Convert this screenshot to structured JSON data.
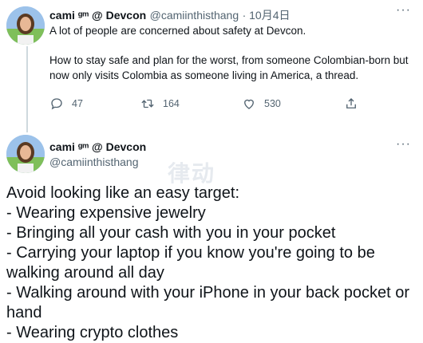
{
  "tweet1": {
    "name": "cami ᵍᵐ @ Devcon",
    "handle": "@camiinthisthang",
    "date": "· 10月4日",
    "text_line1": "A lot of people are concerned about safety at Devcon.",
    "text_para2": "How to stay safe and plan for the worst, from someone Colombian-born but now only visits Colombia as someone living in America, a thread.",
    "more_label": "···",
    "actions": {
      "replies": "47",
      "retweets": "164",
      "likes": "530"
    }
  },
  "tweet2": {
    "name": "cami ᵍᵐ @ Devcon",
    "handle": "@camiinthisthang",
    "more_label": "···",
    "text": "Avoid looking like an easy target:\n- Wearing expensive jewelry\n- Bringing all your cash with you in your pocket\n- Carrying your laptop if you know you're going to be walking around all day\n- Walking around with your iPhone in your back pocket or hand\n- Wearing crypto clothes"
  },
  "watermark": "律动",
  "colors": {
    "text": "#0f1419",
    "secondary": "#536471",
    "thread_line": "#cfd9de"
  },
  "icons": {
    "reply": "reply-icon",
    "retweet": "retweet-icon",
    "like": "like-icon",
    "share": "share-icon",
    "more": "more-icon"
  }
}
